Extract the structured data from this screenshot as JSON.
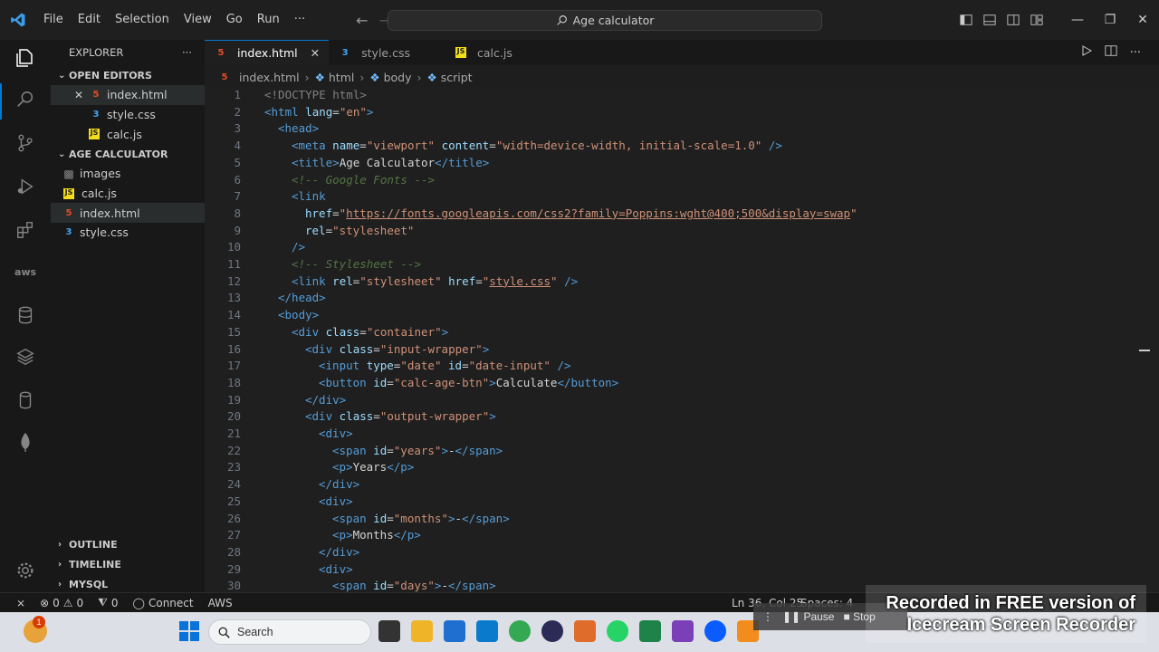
{
  "titlebar": {
    "menu": [
      "File",
      "Edit",
      "Selection",
      "View",
      "Go",
      "Run",
      "···"
    ],
    "search": "Age calculator"
  },
  "explorer": {
    "header": "EXPLORER",
    "more": "···",
    "open_editors": {
      "title": "OPEN EDITORS",
      "items": [
        {
          "name": "index.html",
          "type": "html"
        },
        {
          "name": "style.css",
          "type": "css"
        },
        {
          "name": "calc.js",
          "type": "js"
        }
      ]
    },
    "project": {
      "title": "AGE CALCULATOR",
      "items": [
        {
          "name": "images",
          "type": "folder"
        },
        {
          "name": "calc.js",
          "type": "js"
        },
        {
          "name": "index.html",
          "type": "html"
        },
        {
          "name": "style.css",
          "type": "css"
        }
      ]
    },
    "bottom_sections": [
      "OUTLINE",
      "TIMELINE",
      "MYSQL"
    ]
  },
  "tabs": [
    {
      "label": "index.html",
      "type": "html",
      "active": true
    },
    {
      "label": "style.css",
      "type": "css",
      "active": false
    },
    {
      "label": "calc.js",
      "type": "js",
      "active": false
    }
  ],
  "breadcrumb": [
    "index.html",
    "html",
    "body",
    "script"
  ],
  "code_lines": [
    "1",
    "2",
    "3",
    "4",
    "5",
    "6",
    "7",
    "8",
    "9",
    "10",
    "11",
    "12",
    "13",
    "14",
    "15",
    "16",
    "17",
    "18",
    "19",
    "20",
    "21",
    "22",
    "23",
    "24",
    "25",
    "26",
    "27",
    "28",
    "29",
    "30"
  ],
  "code": {
    "l1_doctype": "<!DOCTYPE html>",
    "l2_html_open": "<html",
    "l2_lang": "lang",
    "l2_lang_val": "\"en\"",
    "l3": "<head>",
    "l4_meta": "<meta",
    "l4_name": "name",
    "l4_name_val": "\"viewport\"",
    "l4_content": "content",
    "l4_content_val": "\"width=device-width, initial-scale=1.0\"",
    "l4_close": "/>",
    "l5_open": "<title>",
    "l5_text": "Age Calculator",
    "l5_close": "</title>",
    "l6": "<!-- Google Fonts -->",
    "l7": "<link",
    "l8_href": "href",
    "l8_url": "https://fonts.googleapis.com/css2?family=Poppins:wght@400;500&display=swap",
    "l9_rel": "rel",
    "l9_val": "\"stylesheet\"",
    "l10": "/>",
    "l11": "<!-- Stylesheet -->",
    "l12_link": "<link",
    "l12_rel": "rel",
    "l12_rel_val": "\"stylesheet\"",
    "l12_href": "href",
    "l12_href_val": "style.css",
    "l12_close": "/>",
    "l13": "</head>",
    "l14": "<body>",
    "l15_div": "<div",
    "l15_class": "class",
    "l15_val": "\"container\"",
    "l16_div": "<div",
    "l16_class": "class",
    "l16_val": "\"input-wrapper\"",
    "l17_input": "<input",
    "l17_type": "type",
    "l17_type_val": "\"date\"",
    "l17_id": "id",
    "l17_id_val": "\"date-input\"",
    "l17_close": "/>",
    "l18_button": "<button",
    "l18_id": "id",
    "l18_id_val": "\"calc-age-btn\"",
    "l18_text": "Calculate",
    "l18_close": "</button>",
    "l19": "</div>",
    "l20_div": "<div",
    "l20_class": "class",
    "l20_val": "\"output-wrapper\"",
    "l21": "<div>",
    "l22_span": "<span",
    "l22_id": "id",
    "l22_val": "\"years\"",
    "l22_text": "-",
    "l22_close": "</span>",
    "l23_open": "<p>",
    "l23_text": "Years",
    "l23_close": "</p>",
    "l24": "</div>",
    "l25": "<div>",
    "l26_span": "<span",
    "l26_id": "id",
    "l26_val": "\"months\"",
    "l26_text": "-",
    "l26_close": "</span>",
    "l27_open": "<p>",
    "l27_text": "Months",
    "l27_close": "</p>",
    "l28": "</div>",
    "l29": "<div>",
    "l30_span": "<span",
    "l30_id": "id",
    "l30_val": "\"days\"",
    "l30_text": "-",
    "l30_close": "</span>"
  },
  "statusbar": {
    "errors": "0",
    "warnings": "0",
    "ports": "0",
    "connect": "Connect",
    "aws": "AWS",
    "position": "Ln 36, Col 25",
    "spaces": "Spaces: 4"
  },
  "taskbar": {
    "search": "Search",
    "notification_count": "1"
  },
  "recorder": {
    "pause": "Pause",
    "stop": "Stop",
    "watermark_line1": "Recorded in FREE version of",
    "watermark_line2": "Icecream  Screen  Recorder"
  },
  "colors": {
    "accent": "#0078d4",
    "html_icon": "#e44d26",
    "css_icon": "#42a5f5",
    "js_icon": "#f5de19"
  }
}
